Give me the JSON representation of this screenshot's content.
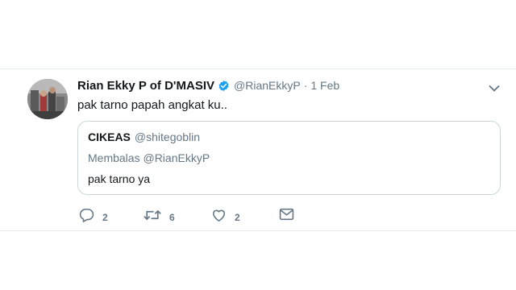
{
  "tweet": {
    "author_name": "Rian Ekky P of D'MASIV",
    "author_handle": "@RianEkkyP",
    "separator": "·",
    "time": "1 Feb",
    "text": "pak tarno papah angkat ku..",
    "quoted": {
      "author_name": "CIKEAS",
      "author_handle": "@shitegoblin",
      "reply_prefix": "Membalas",
      "reply_handle": "@RianEkkyP",
      "text": "pak tarno ya"
    },
    "actions": {
      "reply_count": "2",
      "retweet_count": "6",
      "like_count": "2"
    }
  },
  "colors": {
    "verified": "#1da1f2",
    "secondary_text": "#657786",
    "border": "#ccd6dd",
    "divider": "#e6ecf0"
  },
  "icons": [
    "verified-badge-icon",
    "chevron-down-icon",
    "reply-icon",
    "retweet-icon",
    "like-icon",
    "direct-message-icon"
  ]
}
